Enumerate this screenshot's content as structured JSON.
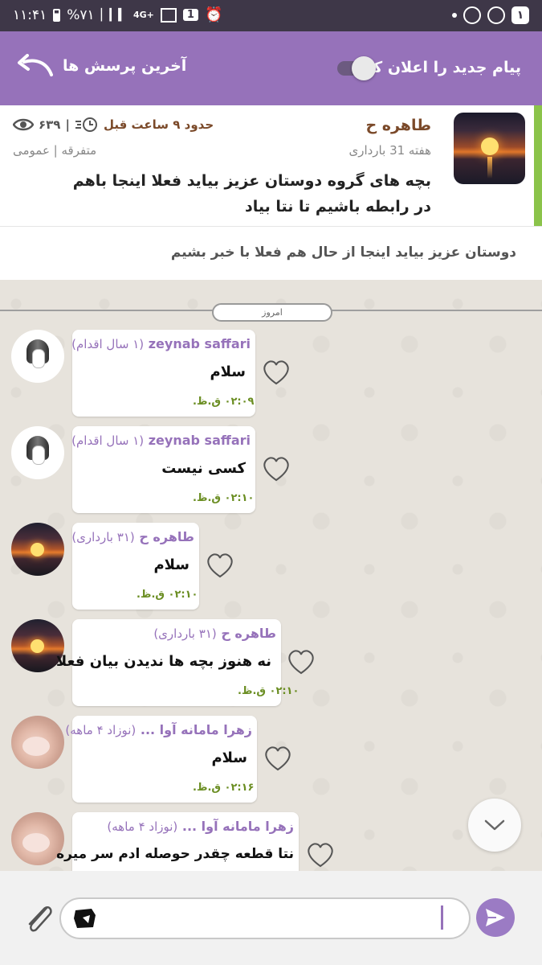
{
  "status_bar": {
    "time": "۱۱:۴۱",
    "battery": "%۷۱",
    "network": "4G+",
    "sim": "1",
    "notif_count": "۱"
  },
  "appbar": {
    "notify_label": "پیام جدید را اعلان کن",
    "latest_label": "آخرین پرسش ها"
  },
  "post": {
    "author": "طاهره ح",
    "week": "هفته 31 بارداری",
    "time_ago": "حدود ۹ ساعت قبل",
    "views": "۶۳۹",
    "categories": "متفرقه | عمومی",
    "title": "بچه های گروه دوستان عزیز بیاید فعلا اینجا باهم در رابطه باشیم تا نتا بیاد"
  },
  "description": "دوستان عزیز بیاید اینجا از حال هم فعلا با خبر بشیم",
  "day_separator": "امروز",
  "messages": [
    {
      "sender": "zeynab saffari",
      "tag": "(۱ سال اقدام)",
      "text": "سلام",
      "time": "۰۲:۰۹ ق.ظ."
    },
    {
      "sender": "zeynab saffari",
      "tag": "(۱ سال اقدام)",
      "text": "کسی نیست",
      "time": "۰۲:۱۰ ق.ظ."
    },
    {
      "sender": "طاهره ح",
      "tag": "(۳۱ بارداری)",
      "text": "سلام",
      "time": "۰۲:۱۰ ق.ظ."
    },
    {
      "sender": "طاهره ح",
      "tag": "(۳۱ بارداری)",
      "text": "نه هنوز بچه ها ندیدن بیان فعلا",
      "time": "۰۲:۱۰ ق.ظ."
    },
    {
      "sender": "زهرا مامانه آوا ...",
      "tag": "(نوزاد ۴ ماهه)",
      "text": "سلام",
      "time": "۰۲:۱۶ ق.ظ."
    },
    {
      "sender": "زهرا مامانه آوا ...",
      "tag": "(نوزاد ۴ ماهه)",
      "text": "نتا قطعه چقدر حوصله ادم سر میره",
      "time": ""
    }
  ],
  "colors": {
    "accent": "#9672ba",
    "status_bar": "#3e3748",
    "post_accent": "#8bc34a",
    "time_text": "#6b8e23"
  }
}
